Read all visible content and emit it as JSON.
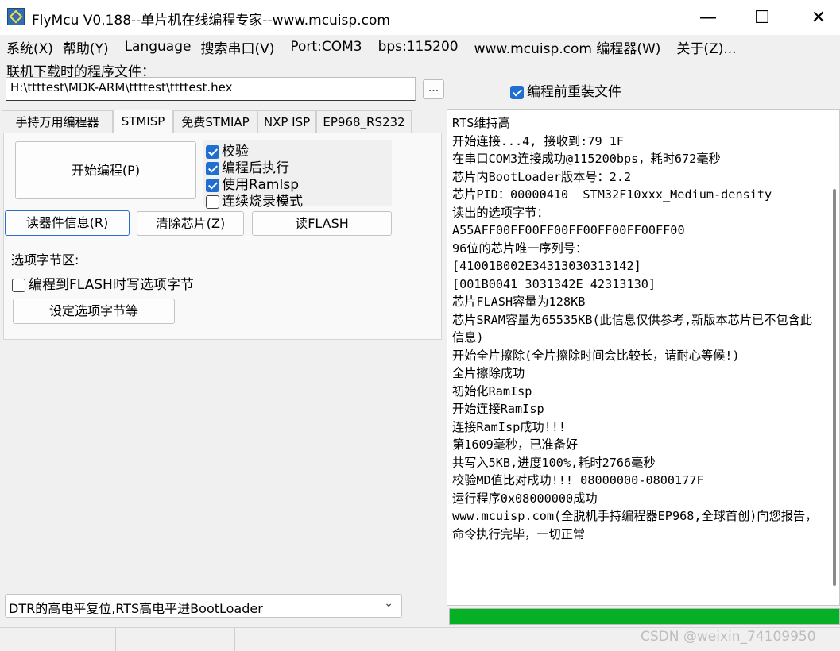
{
  "window": {
    "title": "FlyMcu V0.188--单片机在线编程专家--www.mcuisp.com",
    "minimize": "—",
    "maximize": "☐",
    "close": "✕"
  },
  "menu": [
    "系统(X)",
    "帮助(Y)",
    "Language",
    "搜索串口(V)",
    "Port:COM3",
    "bps:115200",
    "www.mcuisp.com 编程器(W)",
    "关于(Z)..."
  ],
  "file": {
    "label": "联机下载时的程序文件：",
    "path": "H:\\ttttest\\MDK-ARM\\ttttest\\ttttest.hex",
    "browse_label": "...",
    "reprogram_label": "编程前重装文件",
    "reprogram_checked": true
  },
  "tabs": [
    "手持万用编程器",
    "STMISP",
    "免费STMIAP",
    "NXP ISP",
    "EP968_RS232"
  ],
  "active_tab": "STMISP",
  "stmisp": {
    "start_button": "开始编程(P)",
    "checks": [
      {
        "label": "校验",
        "checked": true
      },
      {
        "label": "编程后执行",
        "checked": true
      },
      {
        "label": "使用RamIsp",
        "checked": true
      },
      {
        "label": "连续烧录模式",
        "checked": false
      }
    ],
    "read_info_button": "读器件信息(R)",
    "erase_button": "清除芯片(Z)",
    "read_flash_button": "读FLASH",
    "option_bytes_label": "选项字节区:",
    "write_option_label": "编程到FLASH时写选项字节",
    "write_option_checked": false,
    "set_option_button": "设定选项字节等"
  },
  "dtr_mode": "DTR的高电平复位,RTS高电平进BootLoader",
  "log_lines": [
    "RTS维持高",
    "开始连接...4, 接收到:79 1F",
    "在串口COM3连接成功@115200bps，耗时672毫秒",
    "芯片内BootLoader版本号：2.2",
    "芯片PID：00000410  STM32F10xxx_Medium-density",
    "读出的选项字节：",
    "A55AFF00FF00FF00FF00FF00FF00FF00",
    "96位的芯片唯一序列号：",
    "[41001B002E34313030313142]",
    "[001B0041 3031342E 42313130]",
    "芯片FLASH容量为128KB",
    "芯片SRAM容量为65535KB(此信息仅供参考,新版本芯片已不包含此信息)",
    "开始全片擦除(全片擦除时间会比较长，请耐心等候!)",
    "全片擦除成功",
    "初始化RamIsp",
    "开始连接RamIsp",
    "连接RamIsp成功!!!",
    "第1609毫秒，已准备好",
    "共写入5KB,进度100%,耗时2766毫秒",
    "校验MD值比对成功!!! 08000000-0800177F",
    "运行程序0x08000000成功",
    "www.mcuisp.com(全脱机手持编程器EP968,全球首创)向您报告，命令执行完毕，一切正常"
  ],
  "progress_fraction": 1.0,
  "watermark": "CSDN @weixin_74109950",
  "colors": {
    "progress": "#06b025",
    "checkbox": "#1f6fd0"
  },
  "icons": {
    "app": "flymcu-app-icon",
    "dropdown": "chevron-down-icon"
  }
}
